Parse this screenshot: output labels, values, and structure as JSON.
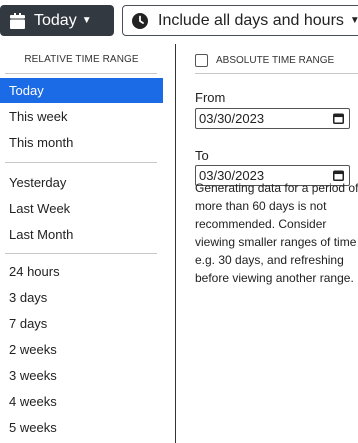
{
  "toolbar": {
    "today_label": "Today",
    "include_label": "Include all days and hours"
  },
  "relative": {
    "heading": "RELATIVE TIME RANGE",
    "items": [
      "Today",
      "This week",
      "This month",
      "Yesterday",
      "Last Week",
      "Last Month",
      "24 hours",
      "3 days",
      "7 days",
      "2 weeks",
      "3 weeks",
      "4 weeks",
      "5 weeks"
    ],
    "selected": "Today"
  },
  "absolute": {
    "checkbox_label": "ABSOLUTE TIME RANGE",
    "checked": false,
    "from_label": "From",
    "from_value": "03/30/2023",
    "to_label": "To",
    "to_value": "03/30/2023",
    "note": "Generating data for a period of more than 60 days is not recommended. Consider viewing smaller ranges of time e.g. 30 days, and refreshing before viewing another range."
  },
  "colors": {
    "dark_button": "#333940",
    "selected_item": "#1b6ae6"
  },
  "icons": [
    "calendar-icon",
    "clock-icon",
    "caret-down-icon",
    "calendar-picker-icon"
  ]
}
